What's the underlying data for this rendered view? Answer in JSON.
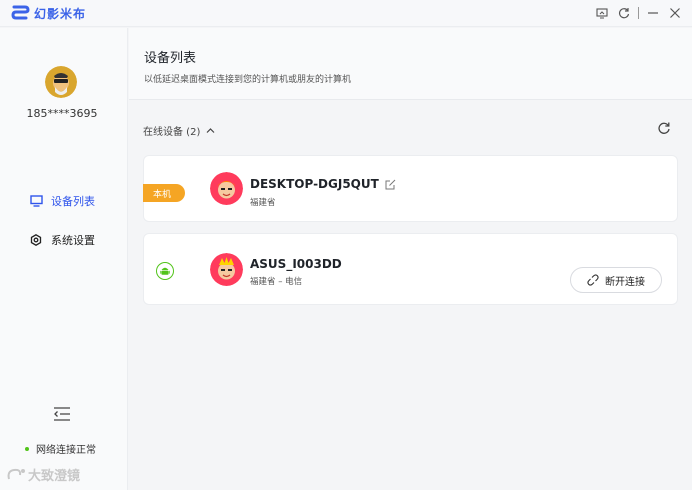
{
  "app": {
    "name": "幻影米布",
    "accent": "#2f54eb"
  },
  "titlebar": {
    "icons": [
      "screen-icon",
      "refresh-icon",
      "minimize-icon",
      "close-icon"
    ]
  },
  "sidebar": {
    "phone": "185****3695",
    "nav": [
      {
        "label": "设备列表",
        "icon": "monitor-icon",
        "active": true
      },
      {
        "label": "系统设置",
        "icon": "gear-icon",
        "active": false
      }
    ],
    "network_status": "网络连接正常",
    "watermark": "大致澄镜"
  },
  "main": {
    "title": "设备列表",
    "subtitle": "以低延迟桌面模式连接到您的计算机或朋友的计算机",
    "section_label": "在线设备 (2)",
    "devices": [
      {
        "tag": "本机",
        "name": "DESKTOP-DGJ5QUT",
        "location": "福建省"
      },
      {
        "name": "ASUS_I003DD",
        "location": "福建省 – 电信",
        "button": "断开连接"
      }
    ]
  },
  "colors": {
    "tag": "#f5a524",
    "status_green": "#52c41a",
    "android_green": "#52c41a"
  }
}
